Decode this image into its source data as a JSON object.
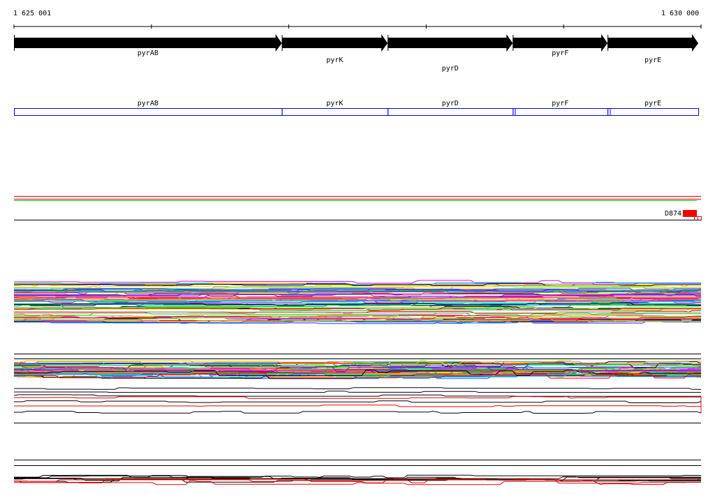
{
  "ruler": {
    "start_label": "1 625 001",
    "end_label": "1 630 000",
    "start": 1625001,
    "end": 1630000
  },
  "genes": [
    {
      "name": "pyrAB",
      "start": 1625001,
      "end": 1626950
    },
    {
      "name": "pyrK",
      "start": 1626950,
      "end": 1627720
    },
    {
      "name": "pyrD",
      "start": 1627720,
      "end": 1628630
    },
    {
      "name": "pyrF",
      "start": 1628630,
      "end": 1629320
    },
    {
      "name": "pyrE",
      "start": 1629320,
      "end": 1629980
    }
  ],
  "feature_track": {
    "label": "D874",
    "color": "#ff0000"
  },
  "colors": {
    "gene": "#000000",
    "annotation_box": "#0000ff",
    "highlight": "#ff0000",
    "green": "#00cc00"
  }
}
